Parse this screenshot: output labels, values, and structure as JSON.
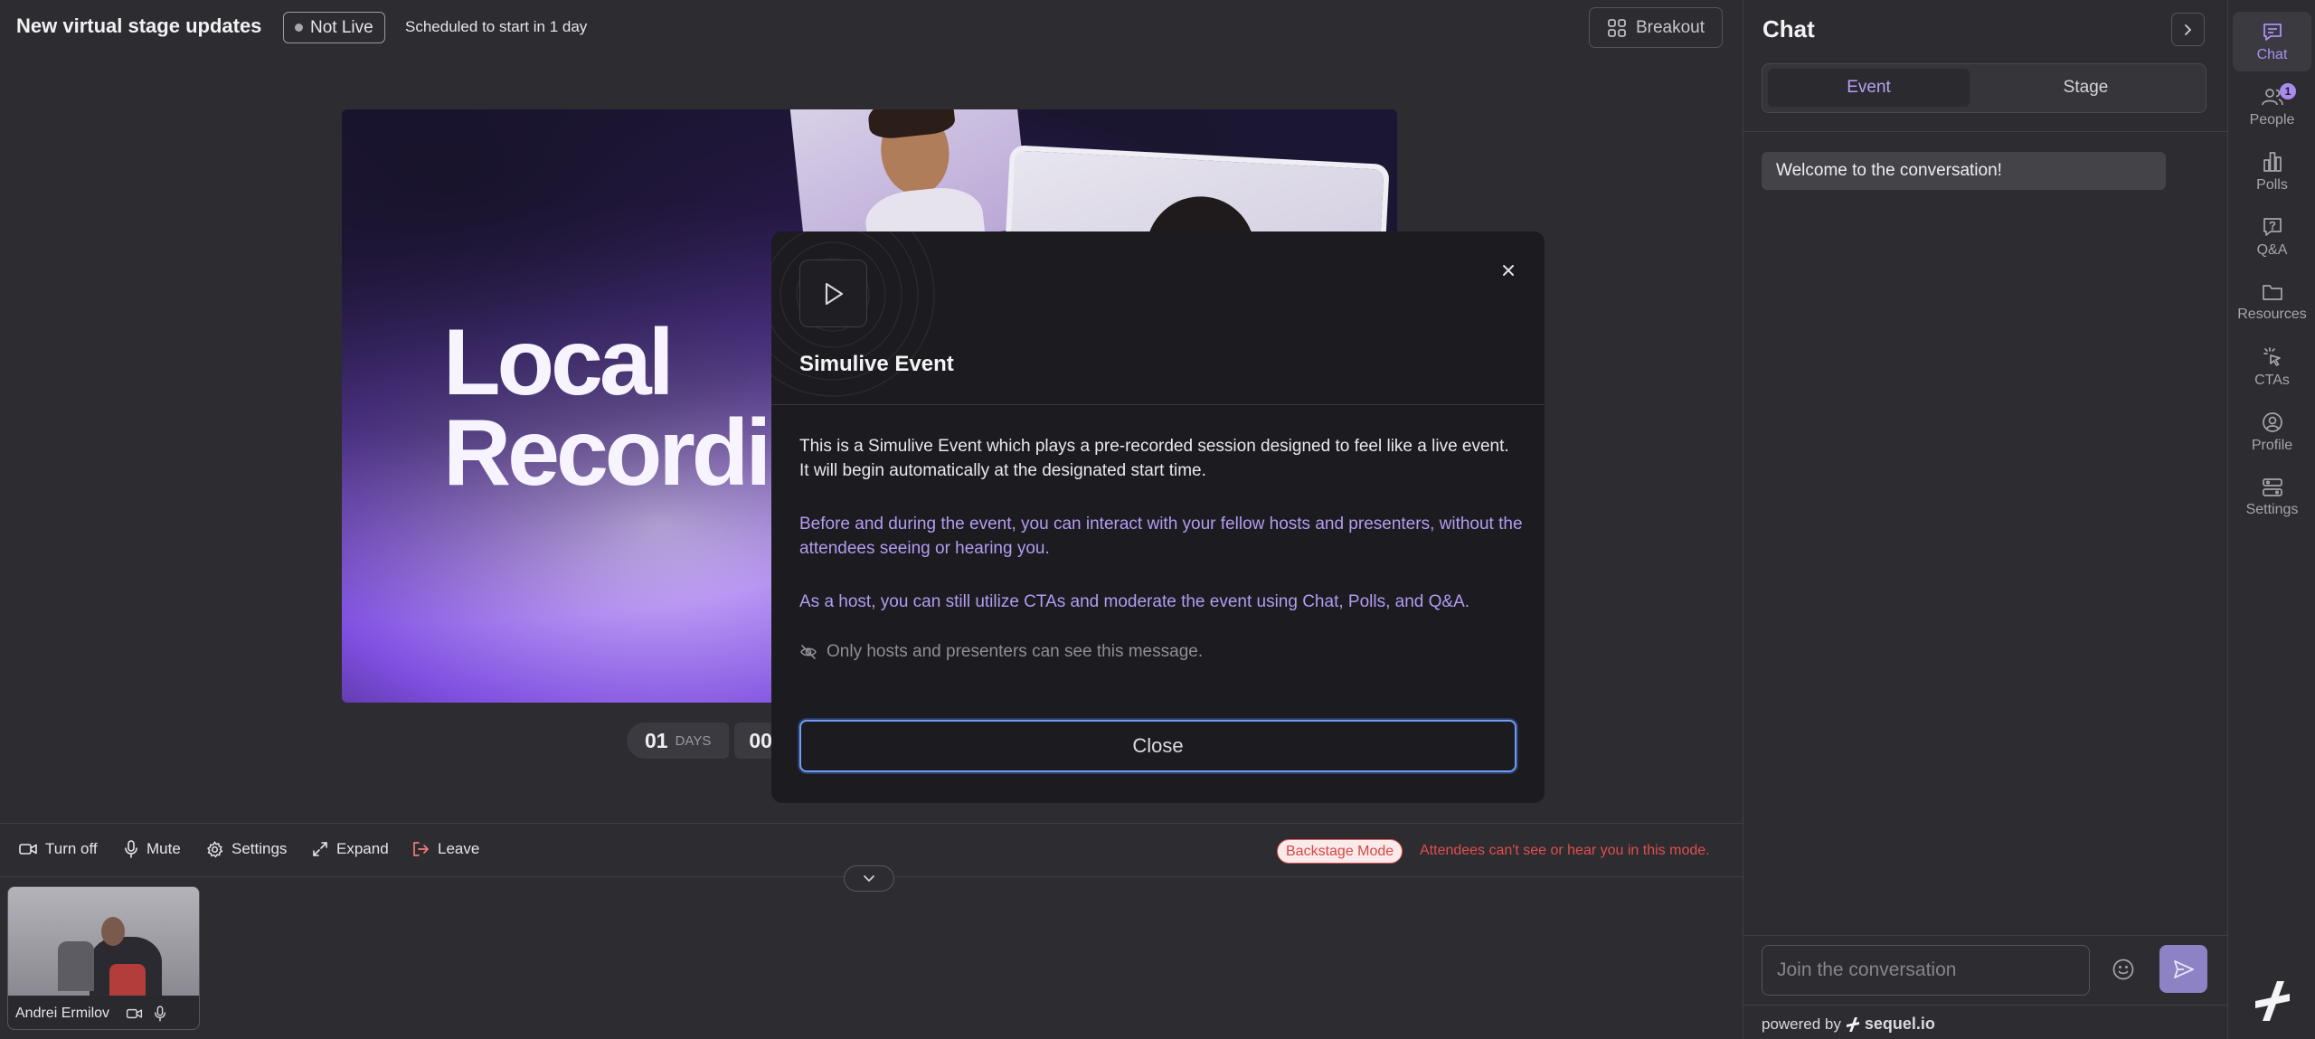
{
  "header": {
    "title": "New virtual stage updates",
    "status": "Not Live",
    "schedule": "Scheduled to start in 1 day",
    "breakout_label": "Breakout"
  },
  "stage": {
    "line1": "Local",
    "line2": "Recordin"
  },
  "countdown": {
    "days": "01",
    "days_label": "DAYS",
    "hours": "00"
  },
  "modal": {
    "title": "Simulive Event",
    "p1": "This is a Simulive Event which plays a pre-recorded session designed to feel like a live event. It will begin automatically at the designated start time.",
    "p2": "Before and during the event, you can interact with your fellow hosts and presenters, without the attendees seeing or hearing you.",
    "p3": "As a host, you can still utilize CTAs and moderate the event using Chat, Polls, and Q&A.",
    "note": "Only hosts and presenters can see this message.",
    "close_label": "Close"
  },
  "toolbar": {
    "turn_off": "Turn off",
    "mute": "Mute",
    "settings": "Settings",
    "expand": "Expand",
    "leave": "Leave",
    "backstage_badge": "Backstage Mode",
    "backstage_msg": "Attendees can't see or hear you in this mode."
  },
  "participant": {
    "name": "Andrei Ermilov"
  },
  "chat": {
    "title": "Chat",
    "tabs": [
      "Event",
      "Stage"
    ],
    "welcome": "Welcome to the conversation!",
    "input_placeholder": "Join the conversation",
    "powered_by": "powered by",
    "brand": "sequel.io"
  },
  "rail": {
    "items": [
      {
        "label": "Chat",
        "icon": "chat-icon",
        "active": true
      },
      {
        "label": "People",
        "icon": "people-icon",
        "badge": "1"
      },
      {
        "label": "Polls",
        "icon": "polls-icon"
      },
      {
        "label": "Q&A",
        "icon": "qa-icon"
      },
      {
        "label": "Resources",
        "icon": "folder-icon"
      },
      {
        "label": "CTAs",
        "icon": "cursor-click-icon"
      },
      {
        "label": "Profile",
        "icon": "profile-icon"
      },
      {
        "label": "Settings",
        "icon": "settings-icon"
      }
    ]
  },
  "colors": {
    "accent": "#a992f0",
    "danger": "#e04e4e",
    "background": "#2d2c30",
    "modal": "#1c1b1f"
  }
}
